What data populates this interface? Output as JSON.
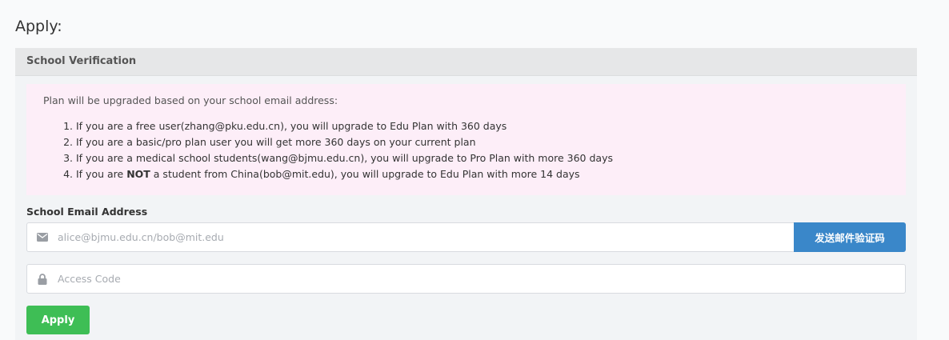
{
  "page": {
    "heading": "Apply:"
  },
  "panel": {
    "header": "School Verification",
    "notice": {
      "intro": "Plan will be upgraded based on your school email address:",
      "items": [
        {
          "before": "If you are a free user(zhang@pku.edu.cn), you will upgrade to Edu Plan with 360 days",
          "bold": "",
          "after": ""
        },
        {
          "before": "If you are a basic/pro plan user you will get more 360 days on your current plan",
          "bold": "",
          "after": ""
        },
        {
          "before": "If you are a medical school students(wang@bjmu.edu.cn), you will upgrade to Pro Plan with more 360 days",
          "bold": "",
          "after": ""
        },
        {
          "before": "If you are ",
          "bold": "NOT",
          "after": " a student from China(bob@mit.edu), you will upgrade to Edu Plan with more 14 days"
        }
      ]
    },
    "email_field": {
      "label": "School Email Address",
      "placeholder": "alice@bjmu.edu.cn/bob@mit.edu",
      "value": "",
      "icon": "envelope-icon"
    },
    "send_code_label": "发送邮件验证码",
    "code_field": {
      "placeholder": "Access Code",
      "value": "",
      "icon": "lock-icon"
    },
    "apply_label": "Apply"
  },
  "colors": {
    "notice_bg": "#fdeef8",
    "send_button": "#3a87c9",
    "apply_button": "#3ebe55"
  }
}
